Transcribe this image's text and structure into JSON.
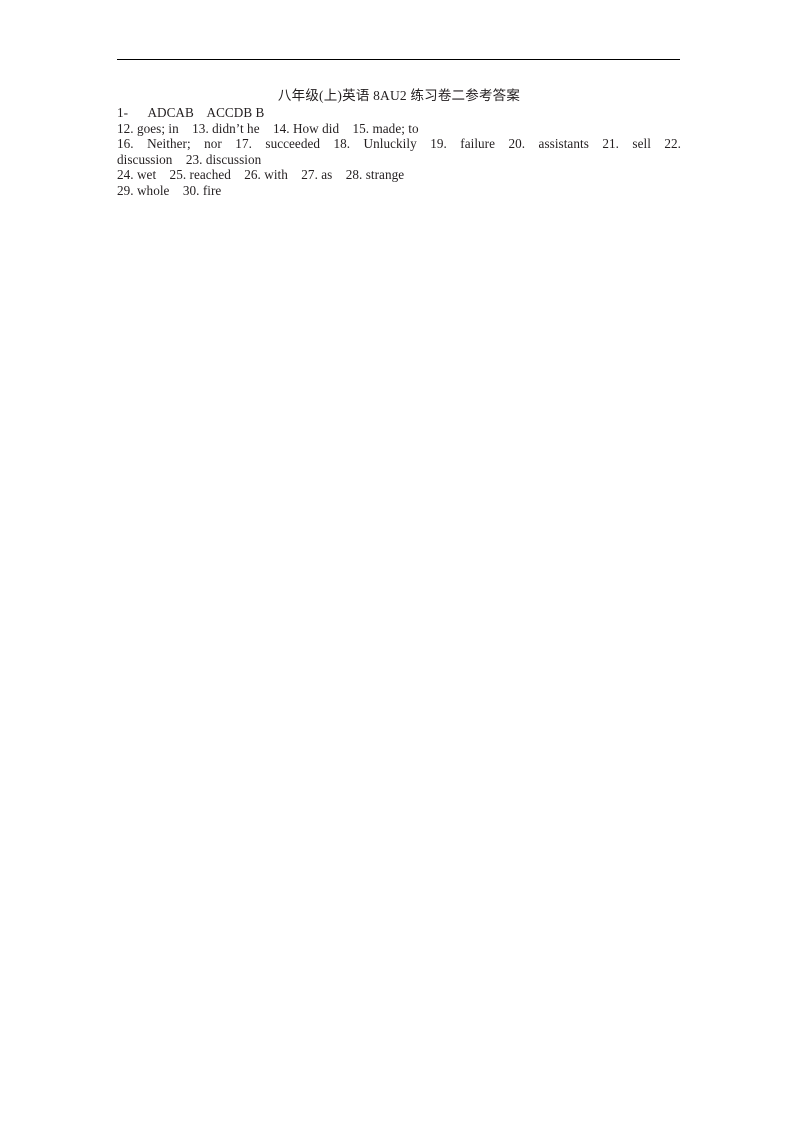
{
  "document": {
    "title": "八年级(上)英语 8AU2 练习卷二参考答案",
    "rule_color": "#000000",
    "text_color": "#231f20",
    "background_color": "#ffffff",
    "lines": [
      "1-      ADCAB    ACCDB B",
      "12. goes; in    13. didn’t he    14. How did    15. made; to",
      "16. Neither; nor    17. succeeded    18. Unluckily 19. failure    20. assistants    21. sell    22.",
      "discussion    23. discussion",
      "24. wet    25. reached    26. with    27. as    28. strange",
      "29. whole    30. fire"
    ],
    "answers": [
      {
        "number": "1-",
        "value": "ADCAB   ACCDB B"
      },
      {
        "number": "12.",
        "value": "goes; in"
      },
      {
        "number": "13.",
        "value": "didn’t he"
      },
      {
        "number": "14.",
        "value": "How did"
      },
      {
        "number": "15.",
        "value": "made; to"
      },
      {
        "number": "16.",
        "value": "Neither; nor"
      },
      {
        "number": "17.",
        "value": "succeeded"
      },
      {
        "number": "18.",
        "value": "Unluckily"
      },
      {
        "number": "19.",
        "value": "failure"
      },
      {
        "number": "20.",
        "value": "assistants"
      },
      {
        "number": "21.",
        "value": "sell"
      },
      {
        "number": "22.",
        "value": "discussion"
      },
      {
        "number": "23.",
        "value": "discussion"
      },
      {
        "number": "24.",
        "value": "wet"
      },
      {
        "number": "25.",
        "value": "reached"
      },
      {
        "number": "26.",
        "value": "with"
      },
      {
        "number": "27.",
        "value": "as"
      },
      {
        "number": "28.",
        "value": "strange"
      },
      {
        "number": "29.",
        "value": "whole"
      },
      {
        "number": "30.",
        "value": "fire"
      }
    ]
  }
}
